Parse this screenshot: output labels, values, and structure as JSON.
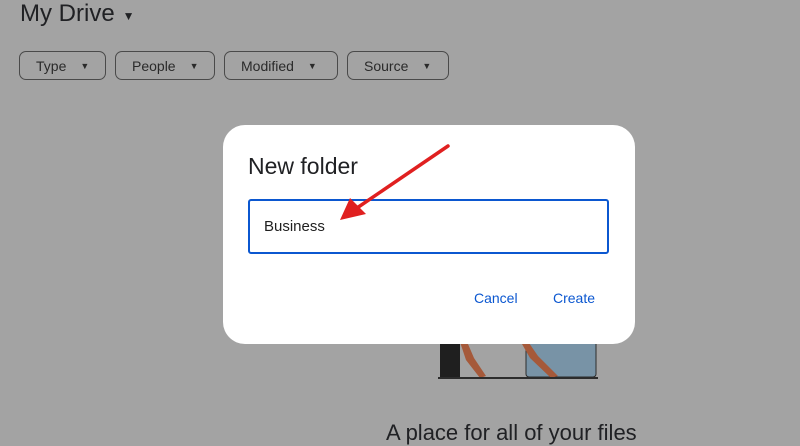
{
  "header": {
    "title": "My Drive",
    "title_caret_icon": "caret-down-icon"
  },
  "filters": [
    {
      "label": "Type"
    },
    {
      "label": "People"
    },
    {
      "label": "Modified"
    },
    {
      "label": "Source"
    }
  ],
  "empty_state": {
    "headline": "A place for all of your files"
  },
  "dialog": {
    "title": "New folder",
    "input_value": "Business",
    "cancel_label": "Cancel",
    "create_label": "Create"
  },
  "colors": {
    "accent": "#0b57d0",
    "overlay": "#a3a3a3",
    "annotation_arrow": "#e02020"
  }
}
